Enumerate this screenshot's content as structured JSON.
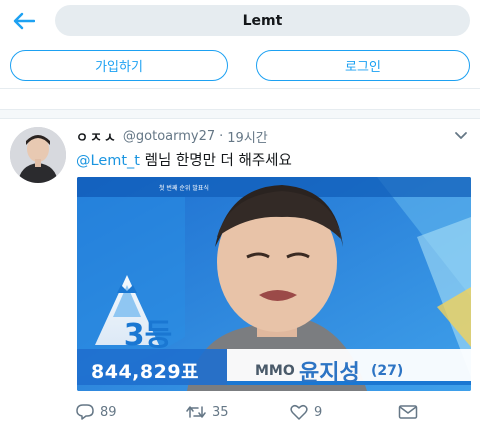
{
  "search": {
    "query": "Lemt"
  },
  "auth": {
    "signup_label": "가입하기",
    "login_label": "로그인"
  },
  "tweet": {
    "display_name": "ㅇㅈㅅ",
    "handle": "@gotoarmy27",
    "separator": "·",
    "time": "19시간",
    "mention": "@Lemt_t",
    "text": " 렘님 한명만 더 해주세요",
    "media": {
      "banner_text": "첫 번째 순위 발표식",
      "rank": "3등",
      "votes": "844,829표",
      "agency": "MMO",
      "name": "윤지성",
      "age": "(27)"
    },
    "stats": {
      "replies": "89",
      "retweets": "35",
      "likes": "9"
    }
  },
  "colors": {
    "accent": "#1da1f2",
    "mention": "#1b95e0",
    "muted": "#657786",
    "search_bg": "#e6ecf0"
  },
  "icons": [
    "back-arrow-icon",
    "chevron-down-icon",
    "reply-icon",
    "retweet-icon",
    "like-icon",
    "dm-icon"
  ]
}
